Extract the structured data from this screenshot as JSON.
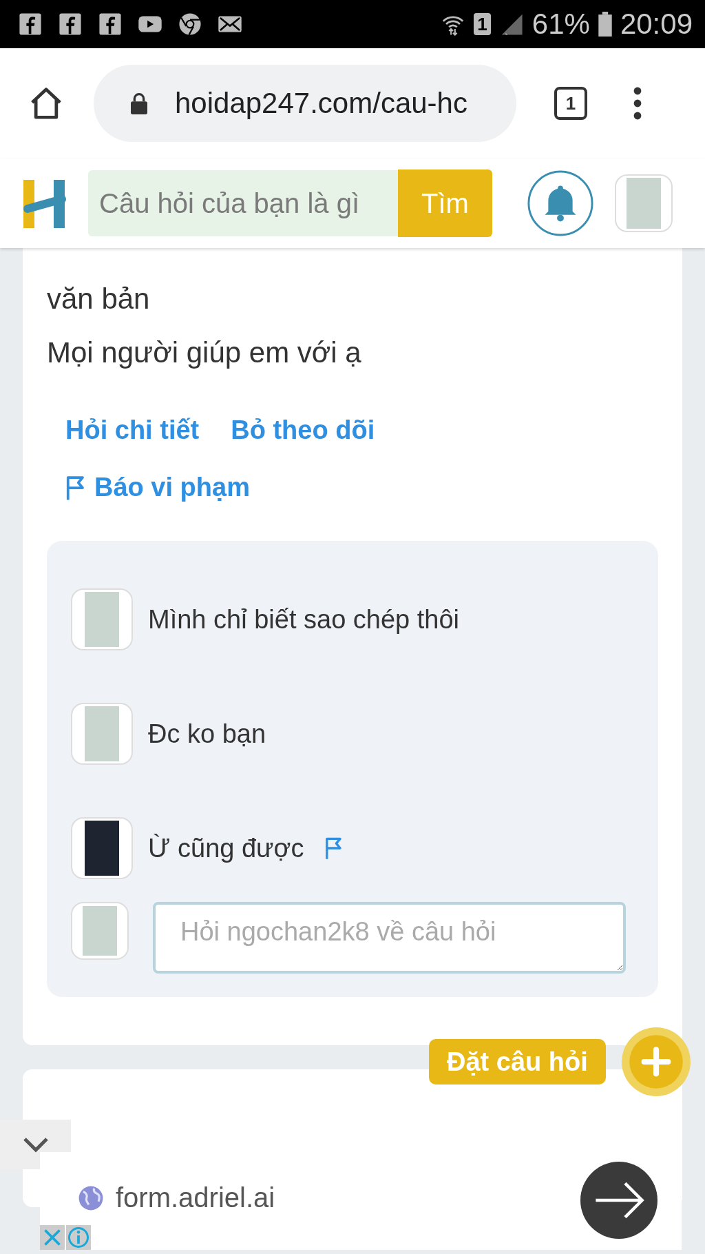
{
  "status_bar": {
    "sim": "1",
    "battery": "61%",
    "time": "20:09"
  },
  "browser": {
    "url": "hoidap247.com/cau-hc",
    "tab_count": "1"
  },
  "site_header": {
    "search": {
      "placeholder": "Câu hỏi của bạn là gì"
    },
    "search_button": "Tìm"
  },
  "question": {
    "lines": [
      "văn bản",
      "Mọi người giúp em với ạ"
    ],
    "actions": [
      "Hỏi chi tiết",
      "Bỏ theo dõi"
    ],
    "report": "Báo vi phạm"
  },
  "comments": [
    {
      "text": "Mình chỉ biết sao chép thôi",
      "color": "#c9d6cf",
      "flag": false
    },
    {
      "text": "Đc ko bạn",
      "color": "#c9d6cf",
      "flag": false
    },
    {
      "text": "Ừ cũng được",
      "color": "#1f2530",
      "flag": true
    }
  ],
  "reply_box": {
    "placeholder": "Hỏi ngochan2k8 về câu hỏi"
  },
  "ask_button": "Đặt câu hỏi",
  "ad": {
    "domain": "form.adriel.ai"
  }
}
